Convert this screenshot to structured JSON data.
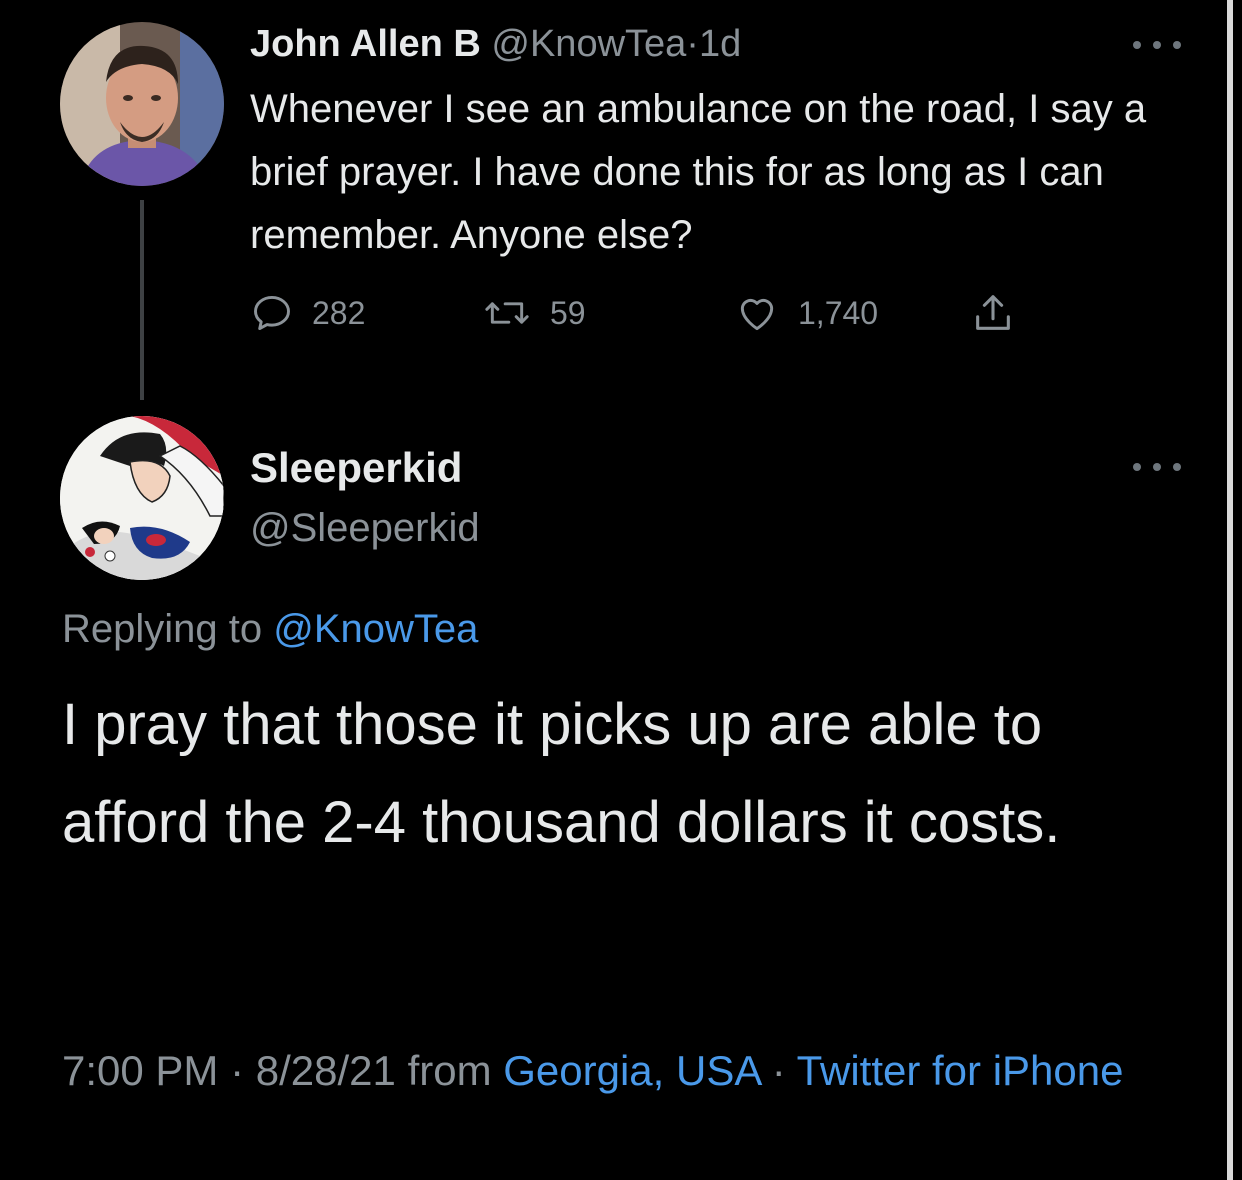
{
  "parent_tweet": {
    "author_name": "John Allen B",
    "handle": "@KnowTea",
    "separator": "·",
    "age": "1d",
    "text": "Whenever I see an ambulance on the road, I say a brief prayer. I have done this for as long as I can remember. Anyone else?",
    "reply_count": "282",
    "retweet_count": "59",
    "like_count": "1,740"
  },
  "reply_tweet": {
    "author_name": "Sleeperkid",
    "handle": "@Sleeperkid",
    "replying_prefix": "Replying to",
    "replying_to": "@KnowTea",
    "text": "I pray that those it picks up are able to afford the 2-4 thousand dollars it costs.",
    "time": "7:00 PM",
    "sep1": "·",
    "date": "8/28/21",
    "from_word": "from",
    "location": "Georgia, USA",
    "sep2": "·",
    "client": "Twitter for iPhone"
  },
  "icons": {
    "reply": "comment-bubble-icon",
    "retweet": "retweet-arrows-icon",
    "like": "heart-icon",
    "share": "share-upload-icon",
    "more": "more-dots-icon"
  },
  "colors": {
    "background": "#000000",
    "primary_text": "#e7e9ea",
    "secondary_text": "#8b9298",
    "link": "#4a99e9"
  }
}
